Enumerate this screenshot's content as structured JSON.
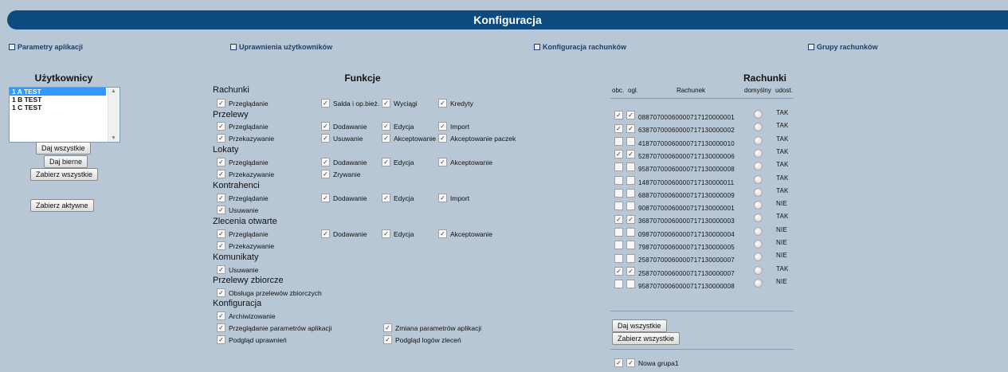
{
  "title": "Konfiguracja",
  "nav": [
    {
      "label": "Parametry aplikacji"
    },
    {
      "label": "Uprawnienia użytkowników"
    },
    {
      "label": "Konfiguracja rachunków"
    },
    {
      "label": "Grupy rachunków"
    }
  ],
  "users": {
    "heading": "Użytkownicy",
    "items": [
      {
        "label": "1 A TEST",
        "selected": true
      },
      {
        "label": "1 B TEST",
        "selected": false
      },
      {
        "label": "1 C TEST",
        "selected": false
      }
    ],
    "buttons": {
      "give_all": "Daj wszystkie",
      "give_passive": "Daj bierne",
      "take_all": "Zabierz wszystkie",
      "take_active": "Zabierz aktywne"
    }
  },
  "functions": {
    "heading": "Funkcje",
    "groups": [
      {
        "title": "Rachunki",
        "rows": [
          [
            {
              "label": "Przeglądanie",
              "checked": true
            },
            {
              "label": "Salda i op.bież.",
              "checked": true
            },
            {
              "label": "Wyciągi",
              "checked": true
            },
            {
              "label": "Kredyty",
              "checked": true
            }
          ]
        ]
      },
      {
        "title": "Przelewy",
        "rows": [
          [
            {
              "label": "Przeglądanie",
              "checked": true
            },
            {
              "label": "Dodawanie",
              "checked": true
            },
            {
              "label": "Edycja",
              "checked": true
            },
            {
              "label": "Import",
              "checked": true
            }
          ],
          [
            {
              "label": "Przekazywanie",
              "checked": true
            },
            {
              "label": "Usuwanie",
              "checked": true
            },
            {
              "label": "Akceptowanie",
              "checked": true
            },
            {
              "label": "Akceptowanie paczek",
              "checked": true
            }
          ]
        ]
      },
      {
        "title": "Lokaty",
        "rows": [
          [
            {
              "label": "Przeglądanie",
              "checked": true
            },
            {
              "label": "Dodawanie",
              "checked": true
            },
            {
              "label": "Edycja",
              "checked": true
            },
            {
              "label": "Akceptowanie",
              "checked": true
            }
          ],
          [
            {
              "label": "Przekazywanie",
              "checked": true
            },
            {
              "label": "Zrywanie",
              "checked": true
            }
          ]
        ]
      },
      {
        "title": "Kontrahenci",
        "rows": [
          [
            {
              "label": "Przeglądanie",
              "checked": true
            },
            {
              "label": "Dodawanie",
              "checked": true
            },
            {
              "label": "Edycja",
              "checked": true
            },
            {
              "label": "Import",
              "checked": true
            }
          ],
          [
            {
              "label": "Usuwanie",
              "checked": true
            }
          ]
        ]
      },
      {
        "title": "Zlecenia otwarte",
        "rows": [
          [
            {
              "label": "Przeglądanie",
              "checked": true
            },
            {
              "label": "Dodawanie",
              "checked": true
            },
            {
              "label": "Edycja",
              "checked": true
            },
            {
              "label": "Akceptowanie",
              "checked": true
            }
          ],
          [
            {
              "label": "Przekazywanie",
              "checked": true
            }
          ]
        ]
      },
      {
        "title": "Komunikaty",
        "rows": [
          [
            {
              "label": "Usuwanie",
              "checked": true
            }
          ]
        ]
      },
      {
        "title": "Przelewy zbiorcze",
        "rows": [
          [
            {
              "label": "Obsługa przelewów zbiorczych",
              "checked": true
            }
          ]
        ]
      },
      {
        "title": "Konfiguracja",
        "rows": [
          [
            {
              "label": "Archiwizowanie",
              "checked": true
            }
          ],
          [
            {
              "label": "Przeglądanie parametrów aplikacji",
              "checked": true
            },
            {
              "label": "Zmiana parametrów aplikacji",
              "checked": true
            }
          ],
          [
            {
              "label": "Podgląd uprawnień",
              "checked": true
            },
            {
              "label": "Podgląd logów zleceń",
              "checked": true
            }
          ]
        ]
      }
    ]
  },
  "accounts": {
    "heading": "Rachunki",
    "col_obc": "obc.",
    "col_ogl": "ogl.",
    "col_account": "Rachunek",
    "col_default": "domyślny",
    "col_shared": "udost.",
    "rows": [
      {
        "obc": true,
        "ogl": true,
        "number": "08870700060000717120000001",
        "shared": "TAK"
      },
      {
        "obc": true,
        "ogl": true,
        "number": "63870700060000717130000002",
        "shared": "TAK"
      },
      {
        "obc": false,
        "ogl": false,
        "number": "41870700060000717130000010",
        "shared": "TAK"
      },
      {
        "obc": true,
        "ogl": true,
        "number": "52870700060000717130000006",
        "shared": "TAK"
      },
      {
        "obc": false,
        "ogl": false,
        "number": "95870700060000717130000008",
        "shared": "TAK"
      },
      {
        "obc": false,
        "ogl": false,
        "number": "14870700060000717130000011",
        "shared": "TAK"
      },
      {
        "obc": false,
        "ogl": false,
        "number": "68870700060000717130000009",
        "shared": "TAK"
      },
      {
        "obc": false,
        "ogl": false,
        "number": "90870700060000717130000001",
        "shared": "NIE"
      },
      {
        "obc": true,
        "ogl": true,
        "number": "36870700060000717130000003",
        "shared": "TAK"
      },
      {
        "obc": false,
        "ogl": false,
        "number": "09870700060000717130000004",
        "shared": "NIE"
      },
      {
        "obc": false,
        "ogl": false,
        "number": "79870700060000717130000005",
        "shared": "NIE"
      },
      {
        "obc": false,
        "ogl": false,
        "number": "25870700060000717130000007",
        "shared": "NIE"
      },
      {
        "obc": true,
        "ogl": true,
        "number": "25870700060000717130000007",
        "shared": "TAK"
      },
      {
        "obc": false,
        "ogl": false,
        "number": "95870700060000717130000008",
        "shared": "NIE"
      }
    ],
    "buttons": {
      "give_all": "Daj wszystkie",
      "take_all": "Zabierz wszystkie"
    },
    "groups": [
      {
        "label": "Nowa grupa1",
        "obc": true,
        "ogl": true
      }
    ]
  }
}
